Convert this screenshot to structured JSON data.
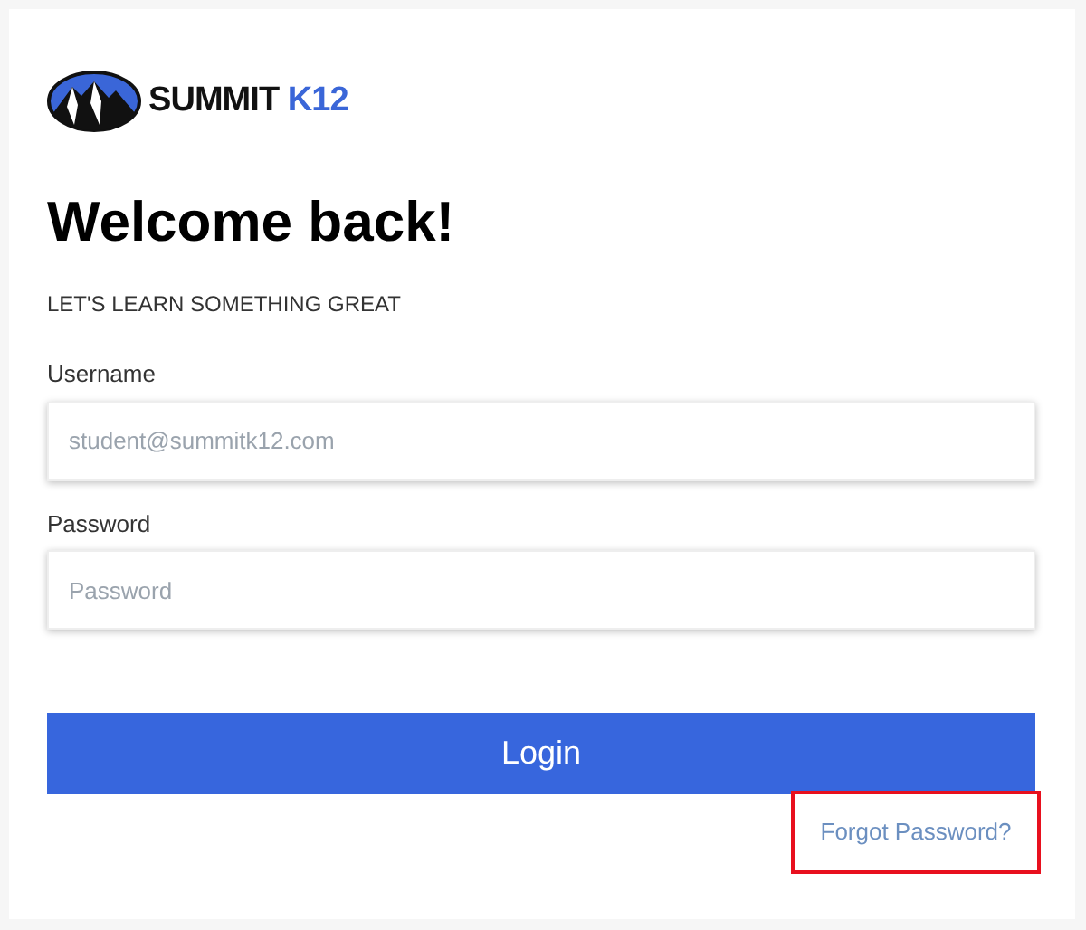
{
  "logo": {
    "word": "SUMMIT",
    "accent": "K12"
  },
  "heading": "Welcome back!",
  "subtitle": "LET'S LEARN SOMETHING GREAT",
  "fields": [
    {
      "label": "Username",
      "placeholder": "student@summitk12.com"
    },
    {
      "label": "Password",
      "placeholder": "Password"
    }
  ],
  "login_button": "Login",
  "forgot_link": {
    "label": "Forgot Password?",
    "highlighted": true
  }
}
